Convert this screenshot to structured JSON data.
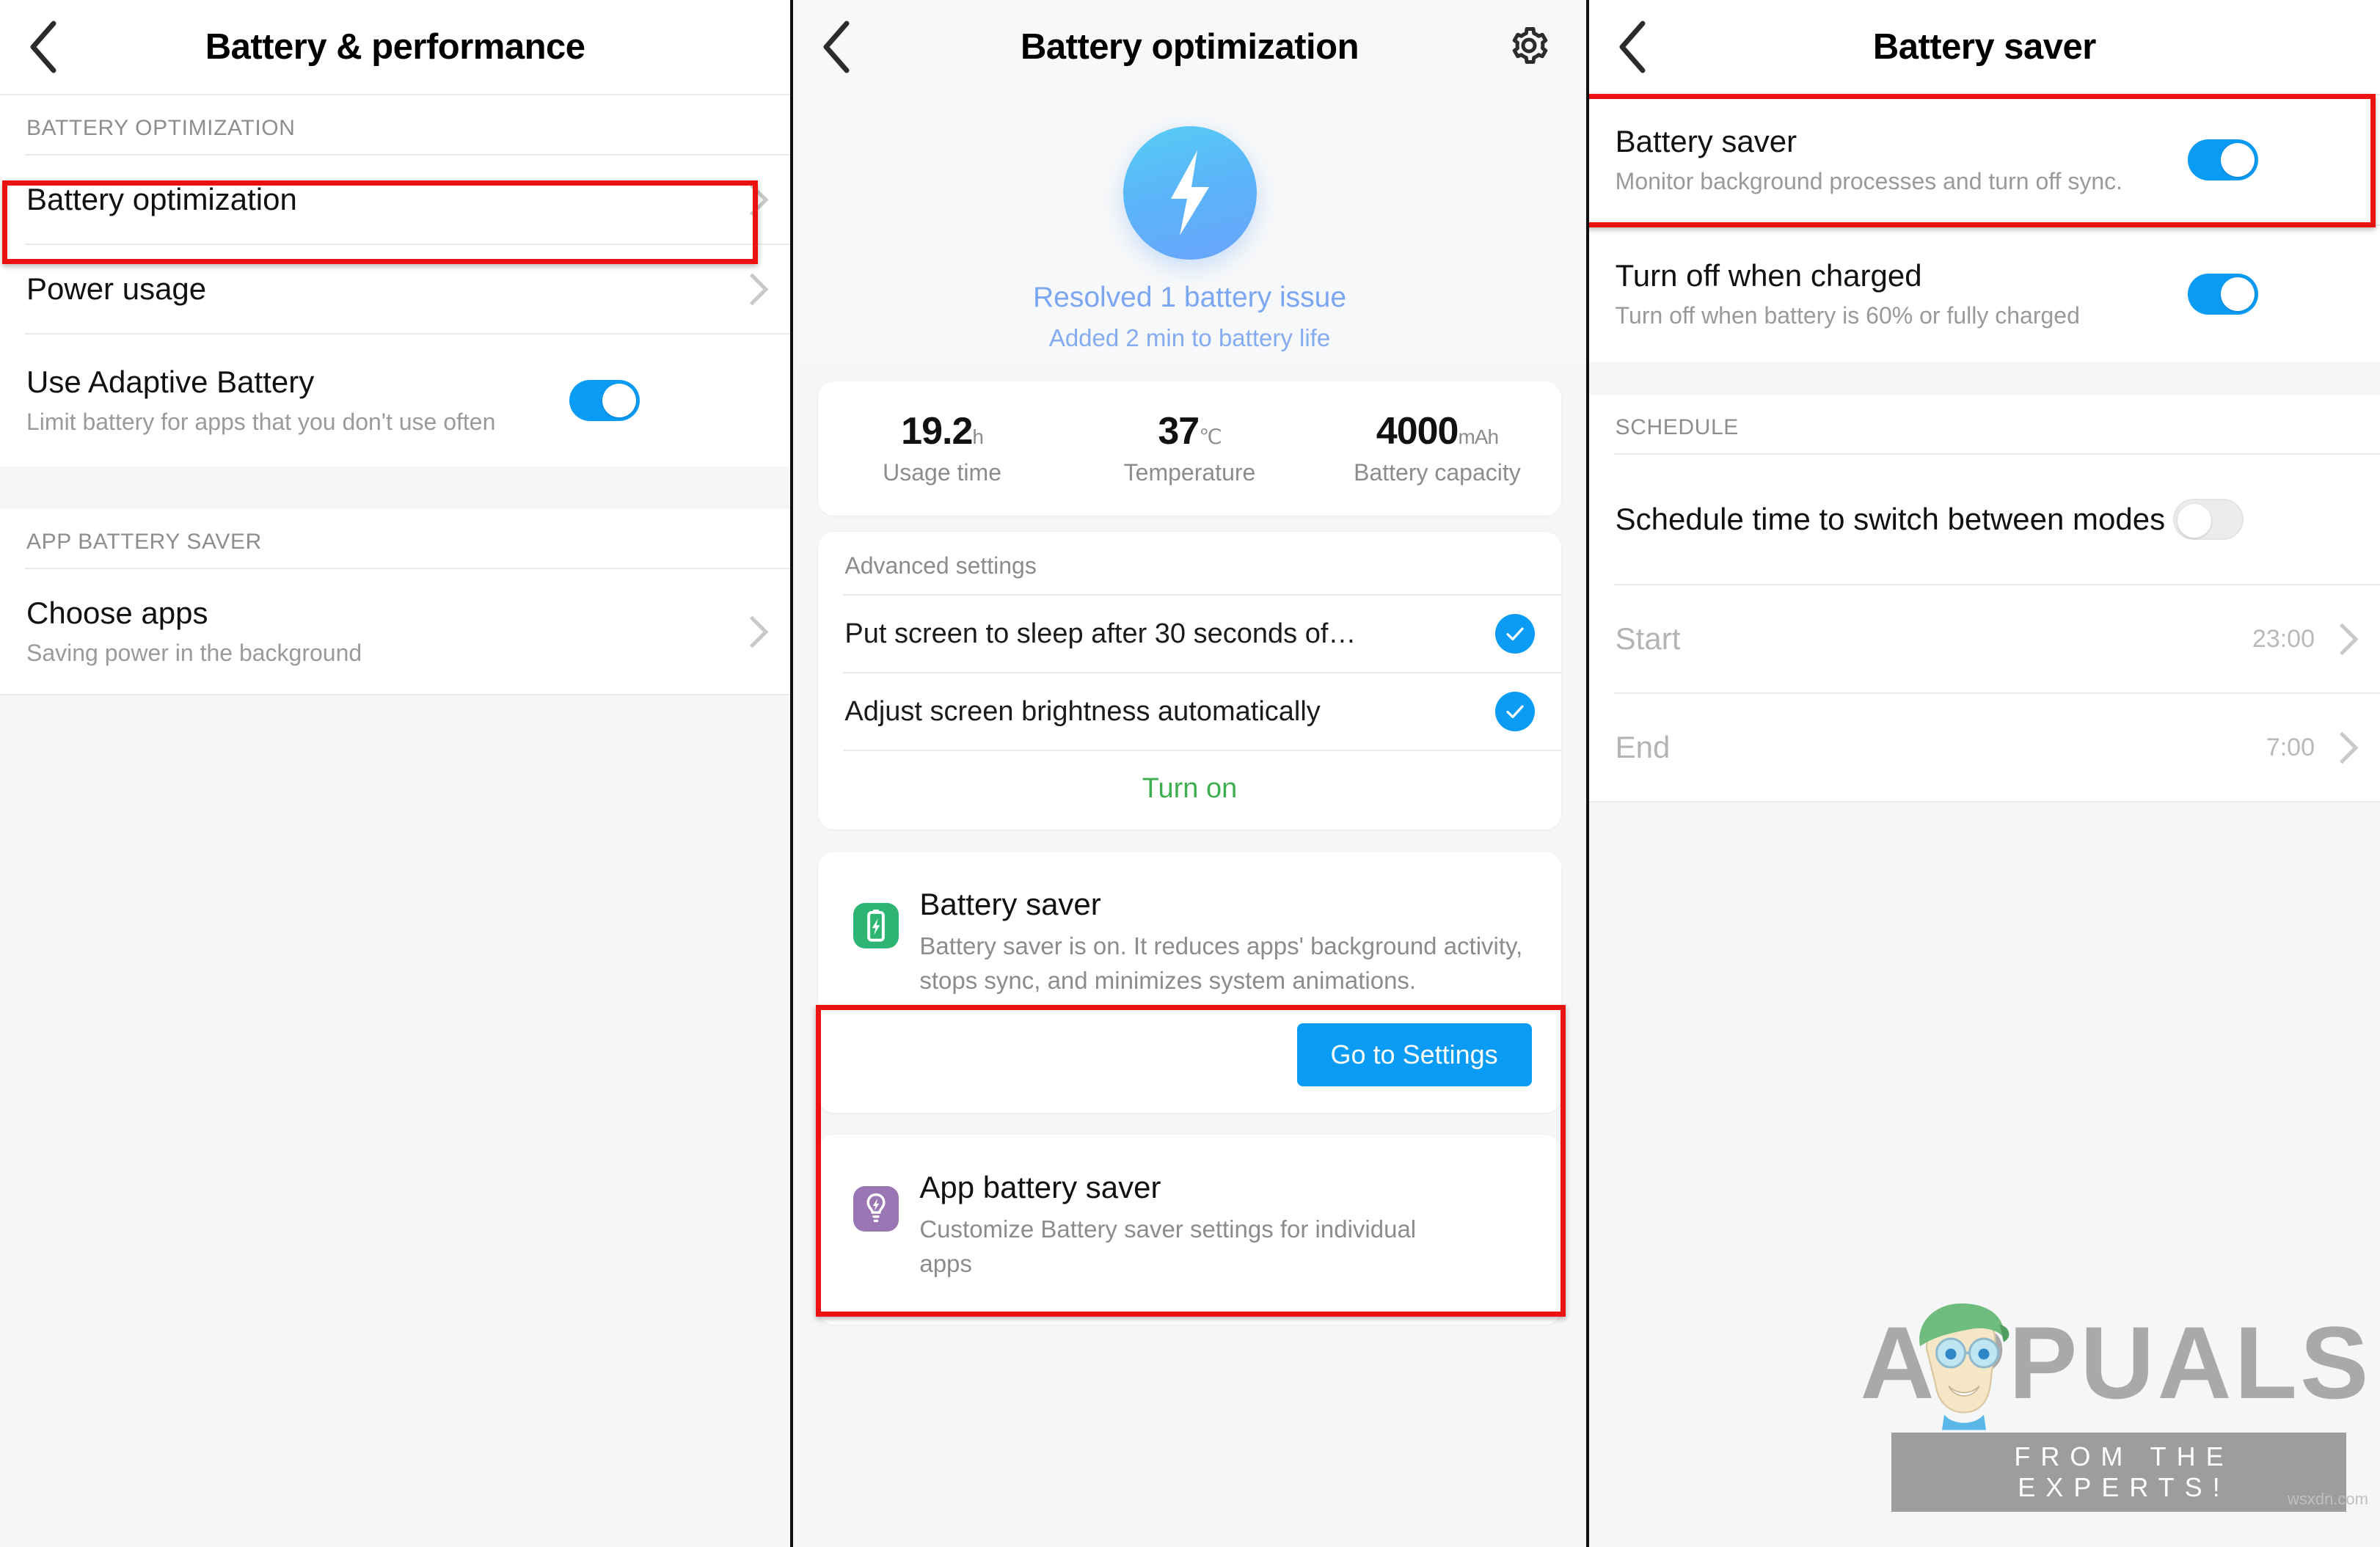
{
  "panel1": {
    "appbar": {
      "title": "Battery & performance",
      "back_icon": "chevron-left-icon"
    },
    "section1_label": "BATTERY OPTIMIZATION",
    "rows": [
      {
        "title": "Battery optimization",
        "sub": "",
        "chevron": true,
        "highlighted": true
      },
      {
        "title": "Power usage",
        "sub": "",
        "chevron": true,
        "highlighted": false
      },
      {
        "title": "Use Adaptive Battery",
        "sub": "Limit battery for apps that you don't use often",
        "toggle": "on"
      }
    ],
    "section2_label": "APP BATTERY SAVER",
    "rows2": [
      {
        "title": "Choose apps",
        "sub": "Saving power in the background",
        "chevron": true
      }
    ]
  },
  "panel2": {
    "appbar": {
      "title": "Battery optimization",
      "back_icon": "chevron-left-icon",
      "settings_icon": "gear-icon"
    },
    "hero": {
      "icon": "lightning-bolt-icon",
      "headline": "Resolved 1 battery issue",
      "subline": "Added 2 min  to battery life"
    },
    "stats": [
      {
        "value": "19.2",
        "unit": "h",
        "label": "Usage time"
      },
      {
        "value": "37",
        "unit": "℃",
        "label": "Temperature"
      },
      {
        "value": "4000",
        "unit": "mAh",
        "label": "Battery capacity"
      }
    ],
    "advanced": {
      "header": "Advanced settings",
      "items": [
        {
          "label": "Put screen to sleep after 30 seconds of…",
          "checked": true
        },
        {
          "label": "Adjust screen brightness automatically",
          "checked": true
        }
      ],
      "action": "Turn on"
    },
    "battery_saver_card": {
      "icon": "battery-charging-icon",
      "title": "Battery saver",
      "desc": "Battery saver is on. It reduces apps' background activity, stops sync, and minimizes system animations.",
      "button": "Go to Settings",
      "highlighted": true
    },
    "app_battery_saver_card": {
      "icon": "bulb-bolt-icon",
      "title": "App battery saver",
      "desc": "Customize Battery saver settings for individual apps"
    }
  },
  "panel3": {
    "appbar": {
      "title": "Battery saver",
      "back_icon": "chevron-left-icon"
    },
    "rows": [
      {
        "title": "Battery saver",
        "sub": "Monitor background processes and turn off sync.",
        "toggle": "on",
        "highlighted": true
      },
      {
        "title": "Turn off when charged",
        "sub": "Turn off when battery is 60% or fully charged",
        "toggle": "on",
        "highlighted": false
      }
    ],
    "schedule_label": "SCHEDULE",
    "schedule_rows": [
      {
        "title": "Schedule time to switch between modes",
        "toggle": "off"
      }
    ],
    "time_rows": [
      {
        "title": "Start",
        "value": "23:00",
        "chevron": true
      },
      {
        "title": "End",
        "value": "7:00",
        "chevron": true
      }
    ]
  },
  "watermark": {
    "brand": "APPUALS",
    "tagline": "FROM THE EXPERTS!",
    "credit": "wsxdn.com"
  },
  "colors": {
    "accent_blue": "#0a9bf5",
    "highlight_red": "#ee1111",
    "green": "#3fae51",
    "hero_blue": "#7ba6f2"
  }
}
